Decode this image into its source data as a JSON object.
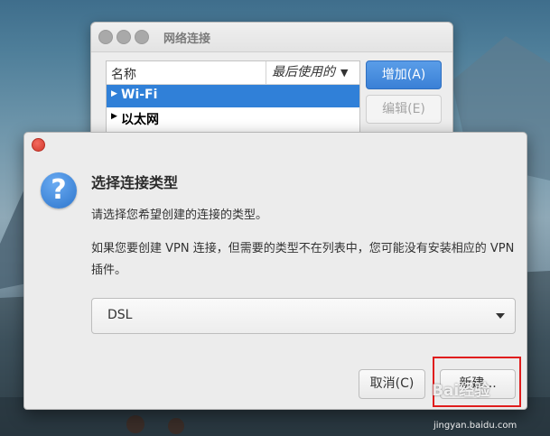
{
  "network_window": {
    "title": "网络连接",
    "list": {
      "col_name": "名称",
      "col_last_used": "最后使用的",
      "rows": [
        {
          "label": "Wi-Fi",
          "selected": true
        },
        {
          "label": "以太网",
          "selected": false
        }
      ]
    },
    "add_button": "增加(A)",
    "edit_button": "编辑(E)"
  },
  "dialog": {
    "heading": "选择连接类型",
    "text1": "请选择您希望创建的连接的类型。",
    "text2": "如果您要创建 VPN 连接，但需要的类型不在列表中，您可能没有安装相应的 VPN 插件。",
    "connection_type": "DSL",
    "cancel_button": "取消(C)",
    "new_button": "新建..."
  },
  "watermark": {
    "text": "Bai经验",
    "url": "jingyan.baidu.com"
  },
  "colors": {
    "accent": "#3080d8",
    "highlight": "#e01d1d"
  }
}
